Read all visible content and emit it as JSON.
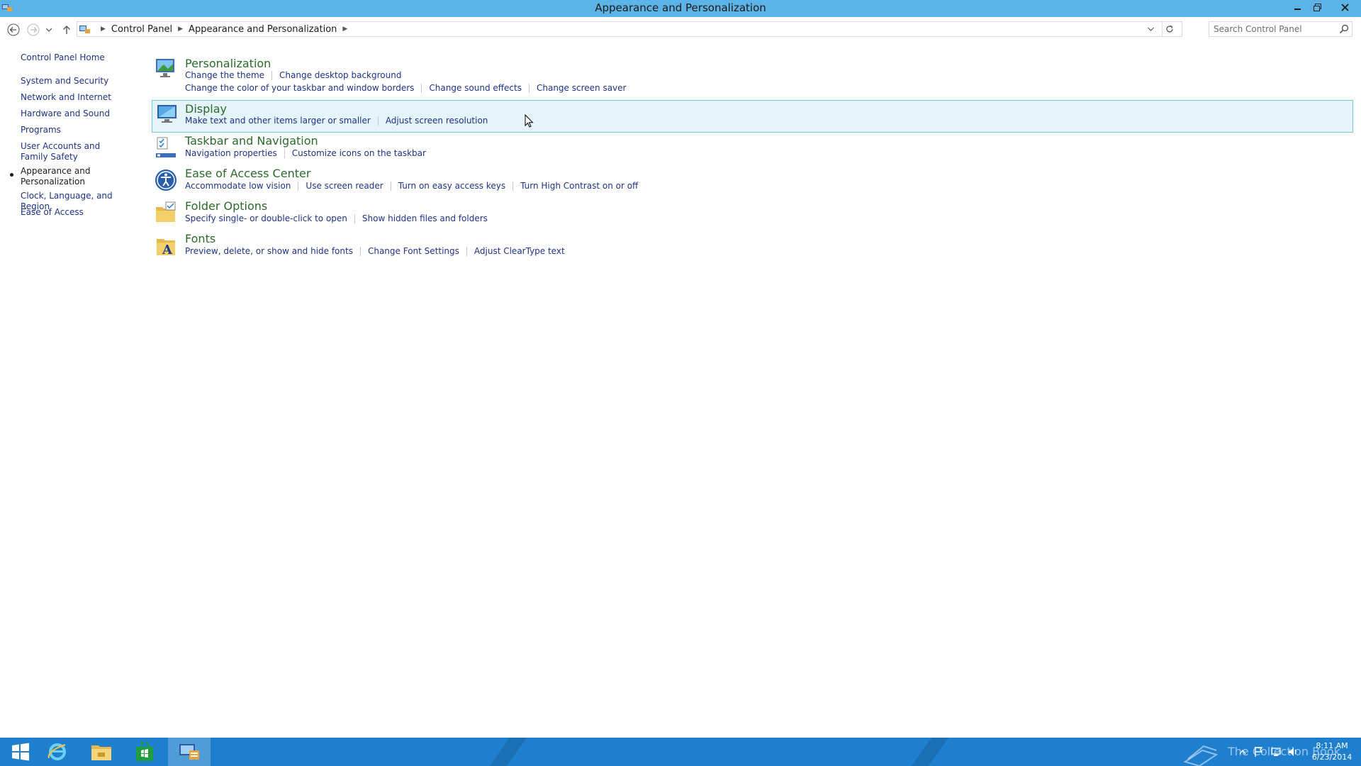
{
  "window": {
    "title": "Appearance and Personalization",
    "controls": [
      "minimize-icon",
      "restore-icon",
      "close-icon"
    ]
  },
  "address": {
    "breadcrumb": [
      "Control Panel",
      "Appearance and Personalization"
    ],
    "search_placeholder": "Search Control Panel"
  },
  "leftnav": {
    "home": "Control Panel Home",
    "items": [
      {
        "label": "System and Security"
      },
      {
        "label": "Network and Internet"
      },
      {
        "label": "Hardware and Sound"
      },
      {
        "label": "Programs"
      },
      {
        "label": "User Accounts and Family Safety"
      },
      {
        "label": "Appearance and Personalization",
        "current": true
      },
      {
        "label": "Clock, Language, and Region"
      },
      {
        "label": "Ease of Access"
      }
    ]
  },
  "categories": [
    {
      "title": "Personalization",
      "icon": "personalization-icon",
      "link_rows": [
        [
          "Change the theme",
          "Change desktop background"
        ],
        [
          "Change the color of your taskbar and window borders",
          "Change sound effects",
          "Change screen saver"
        ]
      ]
    },
    {
      "title": "Display",
      "icon": "display-icon",
      "selected": true,
      "link_rows": [
        [
          "Make text and other items larger or smaller",
          "Adjust screen resolution"
        ]
      ]
    },
    {
      "title": "Taskbar and Navigation",
      "icon": "taskbar-navigation-icon",
      "link_rows": [
        [
          "Navigation properties",
          "Customize icons on the taskbar"
        ]
      ]
    },
    {
      "title": "Ease of Access Center",
      "icon": "ease-of-access-icon",
      "link_rows": [
        [
          "Accommodate low vision",
          "Use screen reader",
          "Turn on easy access keys",
          "Turn High Contrast on or off"
        ]
      ]
    },
    {
      "title": "Folder Options",
      "icon": "folder-options-icon",
      "link_rows": [
        [
          "Specify single- or double-click to open",
          "Show hidden files and folders"
        ]
      ]
    },
    {
      "title": "Fonts",
      "icon": "fonts-icon",
      "link_rows": [
        [
          "Preview, delete, or show and hide fonts",
          "Change Font Settings",
          "Adjust ClearType text"
        ]
      ]
    }
  ],
  "taskbar": {
    "apps": [
      "start-icon",
      "internet-explorer-icon",
      "file-explorer-icon",
      "store-icon",
      "control-panel-icon"
    ],
    "active_app": "control-panel-icon",
    "watermark": "The Collection Book",
    "time": "8:11 AM",
    "date": "6/23/2014"
  },
  "colors": {
    "titlebar": "#5cb3e8",
    "taskbar": "#1f7fcf",
    "link": "#1e3287",
    "category_title": "#2a6a2a",
    "selection_bg": "#e5f3fb",
    "selection_border": "#78c2e8"
  }
}
